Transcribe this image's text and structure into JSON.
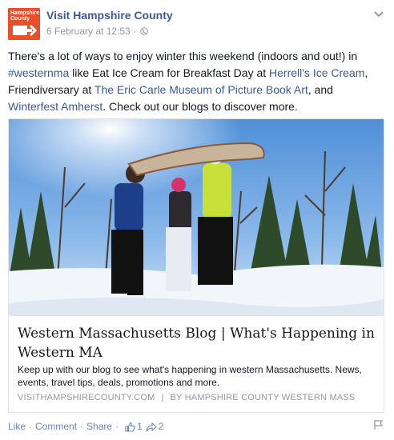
{
  "post": {
    "page_name": "Visit Hampshire County",
    "avatar_text": "Hampshire County",
    "timestamp": "6 February at 12:53",
    "separator": "·",
    "text": {
      "p1": "There's a lot of ways to enjoy winter this weekend (indoors and out!) in ",
      "hashtag": "#westernma",
      "p2": " like Eat Ice Cream for Breakfast Day at ",
      "link1": "Herrell's Ice Cream",
      "p3": ", Friendiversary at ",
      "link2": "The Eric Carle Museum of Picture Book Art",
      "p4": ", and ",
      "link3": "Winterfest Amherst",
      "p5": ". Check out our blogs to discover more."
    },
    "attachment": {
      "title": "Western Massachusetts Blog | What's Happening in Western MA",
      "description": "Keep up with our blog to see what's happening in western Massachusetts. News, events, travel tips, deals, promotions and more.",
      "source_domain": "VISITHAMPSHIRECOUNTY.COM",
      "source_sep": "|",
      "source_author": "BY HAMPSHIRE COUNTY WESTERN MASS"
    },
    "footer": {
      "like": "Like",
      "comment": "Comment",
      "share": "Share",
      "dot": "·",
      "like_count": "1",
      "share_count": "2"
    }
  },
  "colors": {
    "link": "#3b5998",
    "brand_orange": "#e8502a",
    "muted": "#9197a3"
  }
}
